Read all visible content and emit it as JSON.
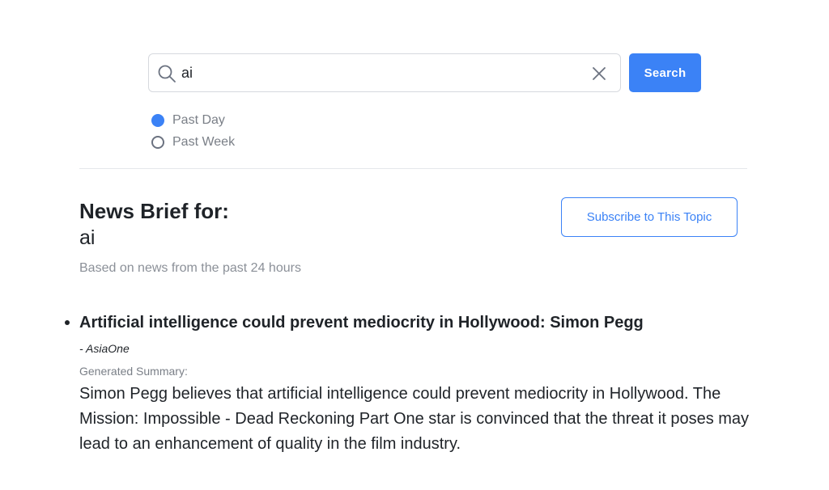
{
  "search": {
    "value": "ai",
    "button_label": "Search"
  },
  "filters": [
    {
      "label": "Past Day",
      "checked": true
    },
    {
      "label": "Past Week",
      "checked": false
    }
  ],
  "brief": {
    "title": "News Brief for:",
    "topic": "ai",
    "subtitle": "Based on news from the past 24 hours",
    "subscribe_label": "Subscribe to This Topic"
  },
  "articles": [
    {
      "title": "Artificial intelligence could prevent mediocrity in Hollywood: Simon Pegg",
      "source": "- AsiaOne",
      "summary_label": "Generated Summary:",
      "summary": "Simon Pegg believes that artificial intelligence could prevent mediocrity in Hollywood. The Mission: Impossible - Dead Reckoning Part One star is convinced that the threat it poses may lead to an enhancement of quality in the film industry."
    }
  ],
  "colors": {
    "accent": "#3b82f6",
    "muted": "#7a7f87"
  }
}
